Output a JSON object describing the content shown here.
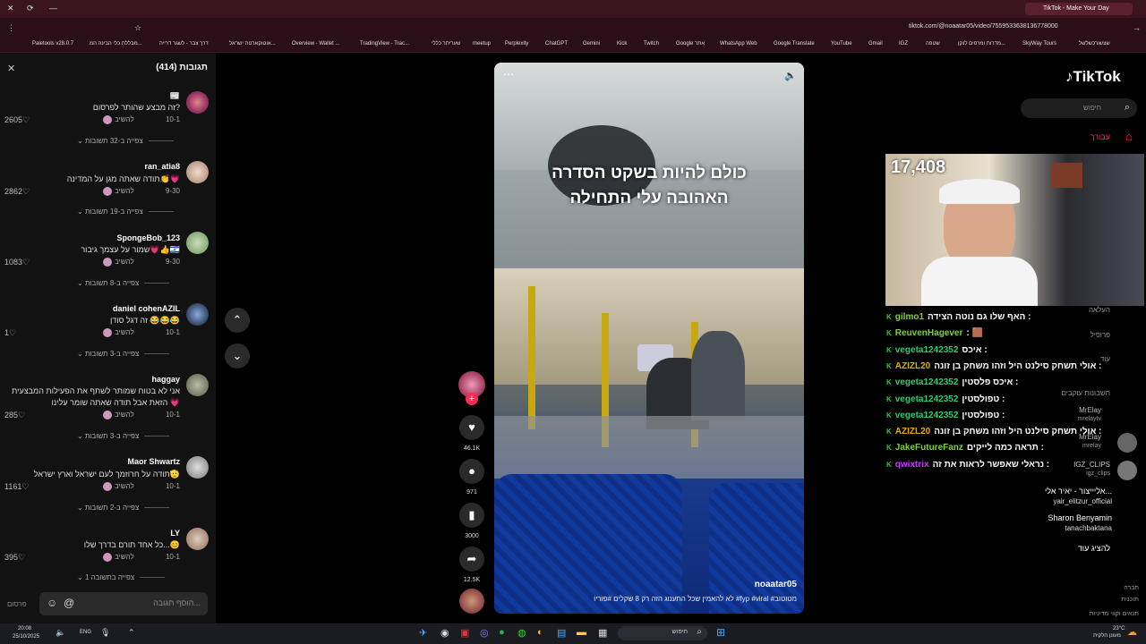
{
  "browser": {
    "tab_title": "TikTok - Make Your Day",
    "url": "tiktok.com/@noaatar05/video/7559533638136778000",
    "bookmarks": [
      "Paletools v28.0.7",
      "מבללת כלי הבינה המ...",
      "דרך צבר - לשגר דרייה",
      "אוטוקארטה ישראל...",
      "Overview - Wallet ...",
      "TradingView - Trac...",
      "שעריתר כללי",
      "meetup",
      "Perplexity",
      "ChatGPT",
      "Gemini",
      "Kick",
      "Twitch",
      "Google אתר",
      "WhatsApp Web",
      "Google Translate",
      "YouTube",
      "Gmail",
      "IGZ",
      "שטפה",
      "מדרות ומרפים לנקן...",
      "SkyWay Tours",
      "שצשורכשלשל"
    ]
  },
  "comments": {
    "header": "תגובות (414)",
    "items": [
      {
        "user": "📰",
        "text": "זה מבצע שהותר לפרסום?",
        "date": "10-1",
        "reply": "להשיב",
        "likes": "2605",
        "more": "צפייה ב-32 תשובות"
      },
      {
        "user": "ran_atia8",
        "text": "תודה שאתה מגן על המדינה👏💗",
        "date": "9-30",
        "reply": "להשיב",
        "likes": "2862",
        "more": "צפייה ב-19 תשובות"
      },
      {
        "user": "SpongeBob_123",
        "text": "שמור על עצמך גיבור💗👍🇮🇱",
        "date": "9-30",
        "reply": "להשיב",
        "likes": "1083",
        "more": "צפייה ב-8 תשובות"
      },
      {
        "user": "daniel cohenAZIL",
        "text": "זה דגל סודן 😂😂😂",
        "date": "10-1",
        "reply": "להשיב",
        "likes": "1",
        "more": "צפייה ב-3 תשובות"
      },
      {
        "user": "haggay",
        "text": "אני לא בטוח שמותר לשתף את הפעילות המבצעית",
        "text2": "הזאת אבל תודה שאתה שומר עלינו 💗",
        "date": "10-1",
        "reply": "להשיב",
        "likes": "285",
        "more": "צפייה ב-3 תשובות"
      },
      {
        "user": "Maor Shwartz",
        "text": "תודה על חרוזמך לעם ישראל וארץ ישראל🫡",
        "date": "10-1",
        "reply": "להשיב",
        "likes": "1161",
        "more": "צפייה ב-2 תשובות"
      },
      {
        "user": "LY",
        "text": "כל אחד תורם בדרך שלו...😊",
        "date": "10-1",
        "reply": "להשיב",
        "likes": "395",
        "more": "צפייה בתשובה 1"
      }
    ],
    "input_placeholder": "הוסף תגובה...",
    "post_label": "פרסום"
  },
  "video": {
    "caption": "כולם להיות בשקט הסדרה האהובה עלי התחילה",
    "author": "noaatar05",
    "description": "לא להאמין שכל התענוג הזה רק 8 שקלים #פוריו #fyp #viral #מטוטוב"
  },
  "actions": {
    "likes": "46.1K",
    "comments": "971",
    "saves": "3000",
    "shares": "12.5K"
  },
  "sidebar": {
    "logo": "TikTok",
    "search_placeholder": "חיפוש",
    "nav_foryou": "עבורך",
    "nav_live": "העלאה",
    "nav_profile": "פרופיל",
    "nav_more": "עוד",
    "following_header": "חשבונות עוקבים",
    "accounts": [
      {
        "name": "MrElay",
        "handle": "mrelaytv"
      },
      {
        "name": "MrElay",
        "handle": "mrelay"
      },
      {
        "name": "IGZ_CLIPS",
        "handle": "igz_clips"
      },
      {
        "name": "אליייצור - יאיר אלי...",
        "handle": "yair_elitzur_official"
      },
      {
        "name": "Sharon Benyamin",
        "handle": "tanachbaktana"
      }
    ],
    "show_more": "להציג עוד",
    "footer": [
      "חברה",
      "תוכנית",
      "תנאים וקווי מדיניות"
    ]
  },
  "stream": {
    "viewers": "17,408",
    "chat": [
      {
        "user": "gilmo1",
        "msg": "האף שלו גם נוטה הצידה :",
        "color": "#7dd03a"
      },
      {
        "user": "ReuvenHagever",
        "msg": ": 🟫",
        "color": "#7dd03a"
      },
      {
        "user": "vegeta1242352",
        "msg": "איכס :",
        "color": "#2ecc71"
      },
      {
        "user": "AZIZL20",
        "msg": "אולי תשחק סילנט היל וזהו משחק בן זונה :",
        "color": "#e0b000"
      },
      {
        "user": "vegeta1242352",
        "msg": "איכס פלסטין :",
        "color": "#2ecc71"
      },
      {
        "user": "vegeta1242352",
        "msg": "טפולסטין :",
        "color": "#2ecc71"
      },
      {
        "user": "vegeta1242352",
        "msg": "טפולסטין :",
        "color": "#2ecc71"
      },
      {
        "user": "AZIZL20",
        "msg": "אולי תשחק סילנט היל וזהו משחק בן זונה :",
        "color": "#e0b000"
      },
      {
        "user": "JakeFutureFanz",
        "msg": "תראה כמה לייקים :",
        "color": "#7dd03a"
      },
      {
        "user": "qwixtrix",
        "msg": "נראלי שאפשר לראות את זה :",
        "color": "#c33cff"
      }
    ]
  },
  "taskbar": {
    "time": "20:08",
    "date": "25/10/2025",
    "lang": "ENG",
    "search": "חיפוש",
    "weather": "23°C",
    "weather_desc": "מעונן חלקית"
  },
  "colors": {
    "accent": "#fe2c55",
    "bg": "#000000",
    "panel": "#121212",
    "browser": "#3a1520"
  }
}
